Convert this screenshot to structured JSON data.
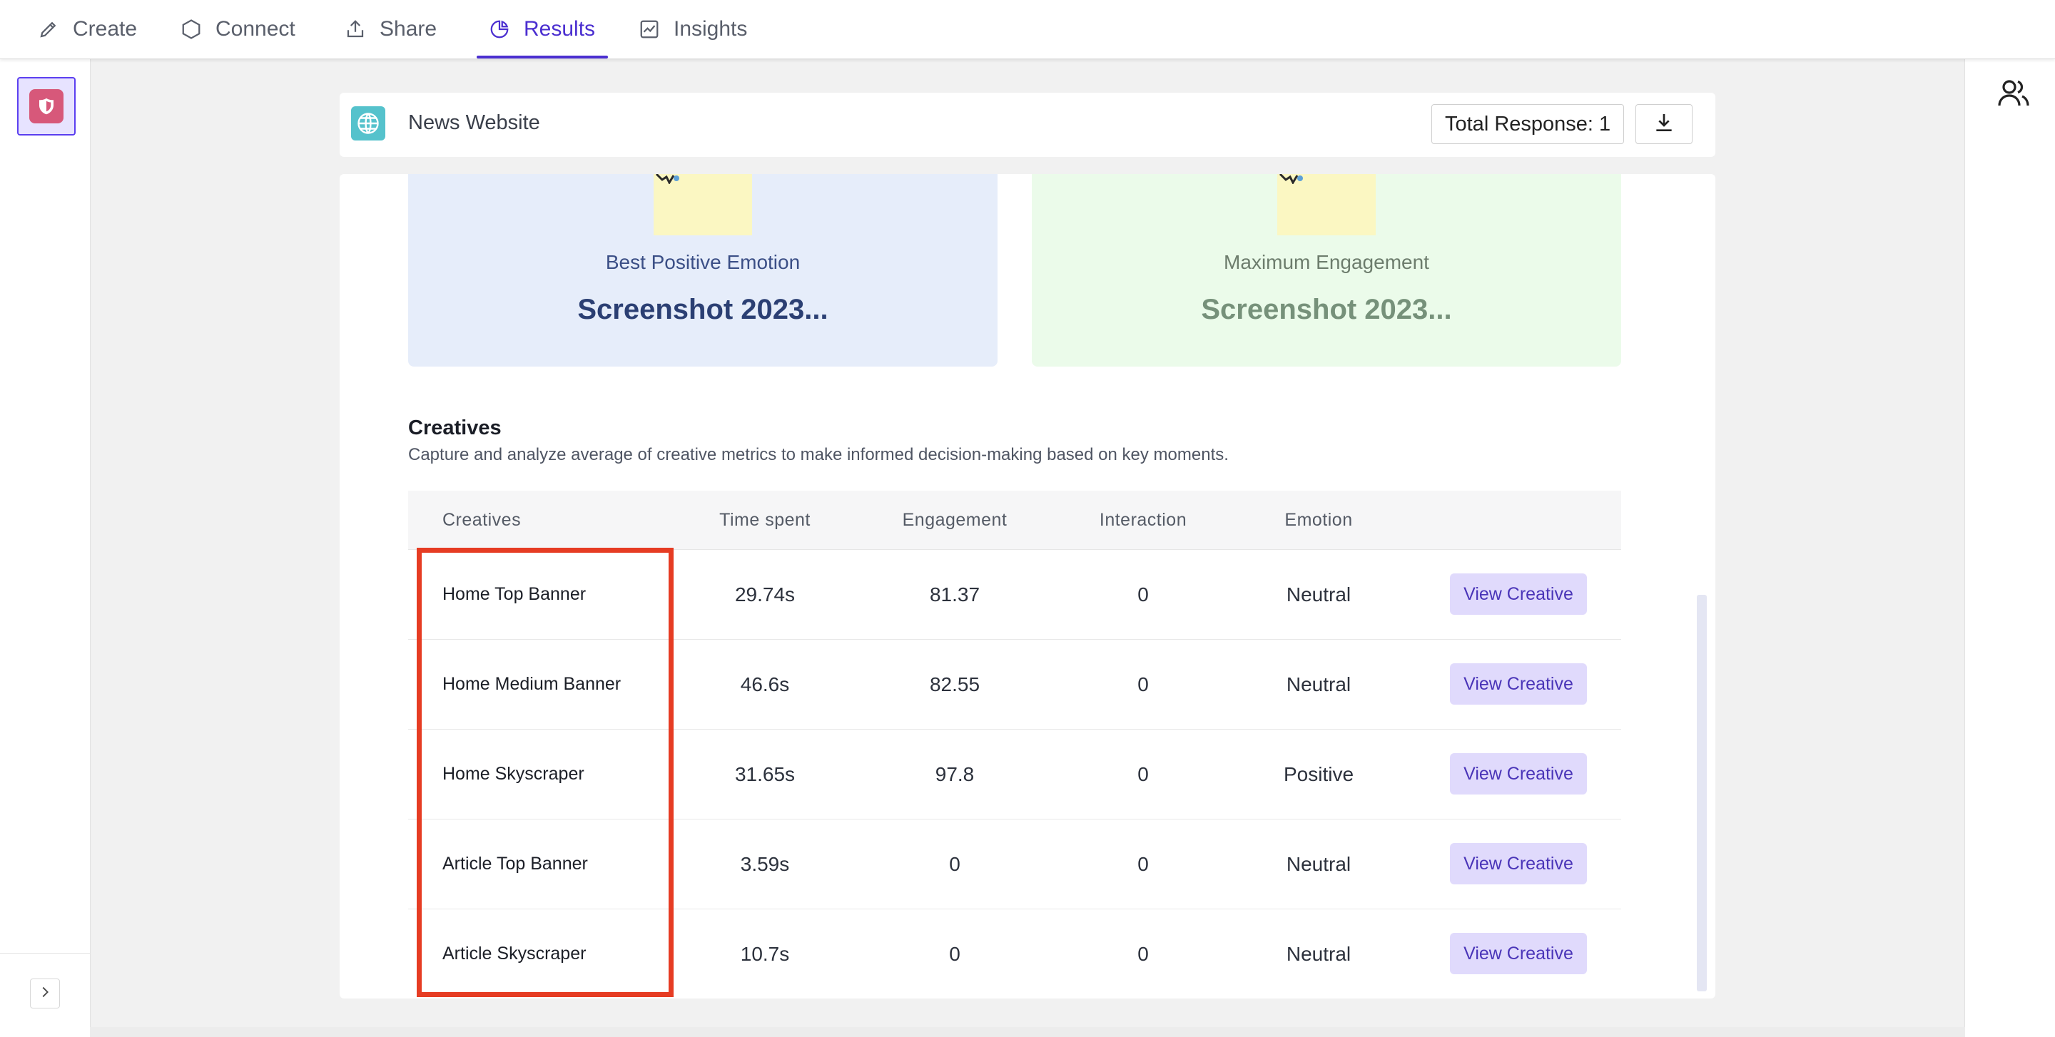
{
  "nav": {
    "tabs": [
      {
        "label": "Create",
        "icon": "pencil-icon"
      },
      {
        "label": "Connect",
        "icon": "hexagon-icon"
      },
      {
        "label": "Share",
        "icon": "share-icon"
      },
      {
        "label": "Results",
        "icon": "pie-chart-icon",
        "active": true
      },
      {
        "label": "Insights",
        "icon": "line-chart-icon"
      }
    ]
  },
  "header": {
    "site_name": "News Website",
    "total_response": "Total Response: 1"
  },
  "highlights": [
    {
      "label": "Best Positive Emotion",
      "value": "Screenshot 2023..."
    },
    {
      "label": "Maximum Engagement",
      "value": "Screenshot 2023..."
    }
  ],
  "section": {
    "title": "Creatives",
    "description": "Capture and analyze average of creative metrics to make informed decision-making based on key moments."
  },
  "table": {
    "columns": [
      "Creatives",
      "Time spent",
      "Engagement",
      "Interaction",
      "Emotion"
    ],
    "rows": [
      {
        "name": "Home Top Banner",
        "time": "29.74s",
        "engagement": "81.37",
        "interaction": "0",
        "emotion": "Neutral",
        "action": "View Creative"
      },
      {
        "name": "Home Medium Banner",
        "time": "46.6s",
        "engagement": "82.55",
        "interaction": "0",
        "emotion": "Neutral",
        "action": "View Creative"
      },
      {
        "name": "Home Skyscraper",
        "time": "31.65s",
        "engagement": "97.8",
        "interaction": "0",
        "emotion": "Positive",
        "action": "View Creative"
      },
      {
        "name": "Article Top Banner",
        "time": "3.59s",
        "engagement": "0",
        "interaction": "0",
        "emotion": "Neutral",
        "action": "View Creative"
      },
      {
        "name": "Article Skyscraper",
        "time": "10.7s",
        "engagement": "0",
        "interaction": "0",
        "emotion": "Neutral",
        "action": "View Creative"
      }
    ]
  },
  "colors": {
    "accent": "#4b2fd0",
    "highlight_box": "#e63c23",
    "view_button_bg": "#e0dafc"
  }
}
